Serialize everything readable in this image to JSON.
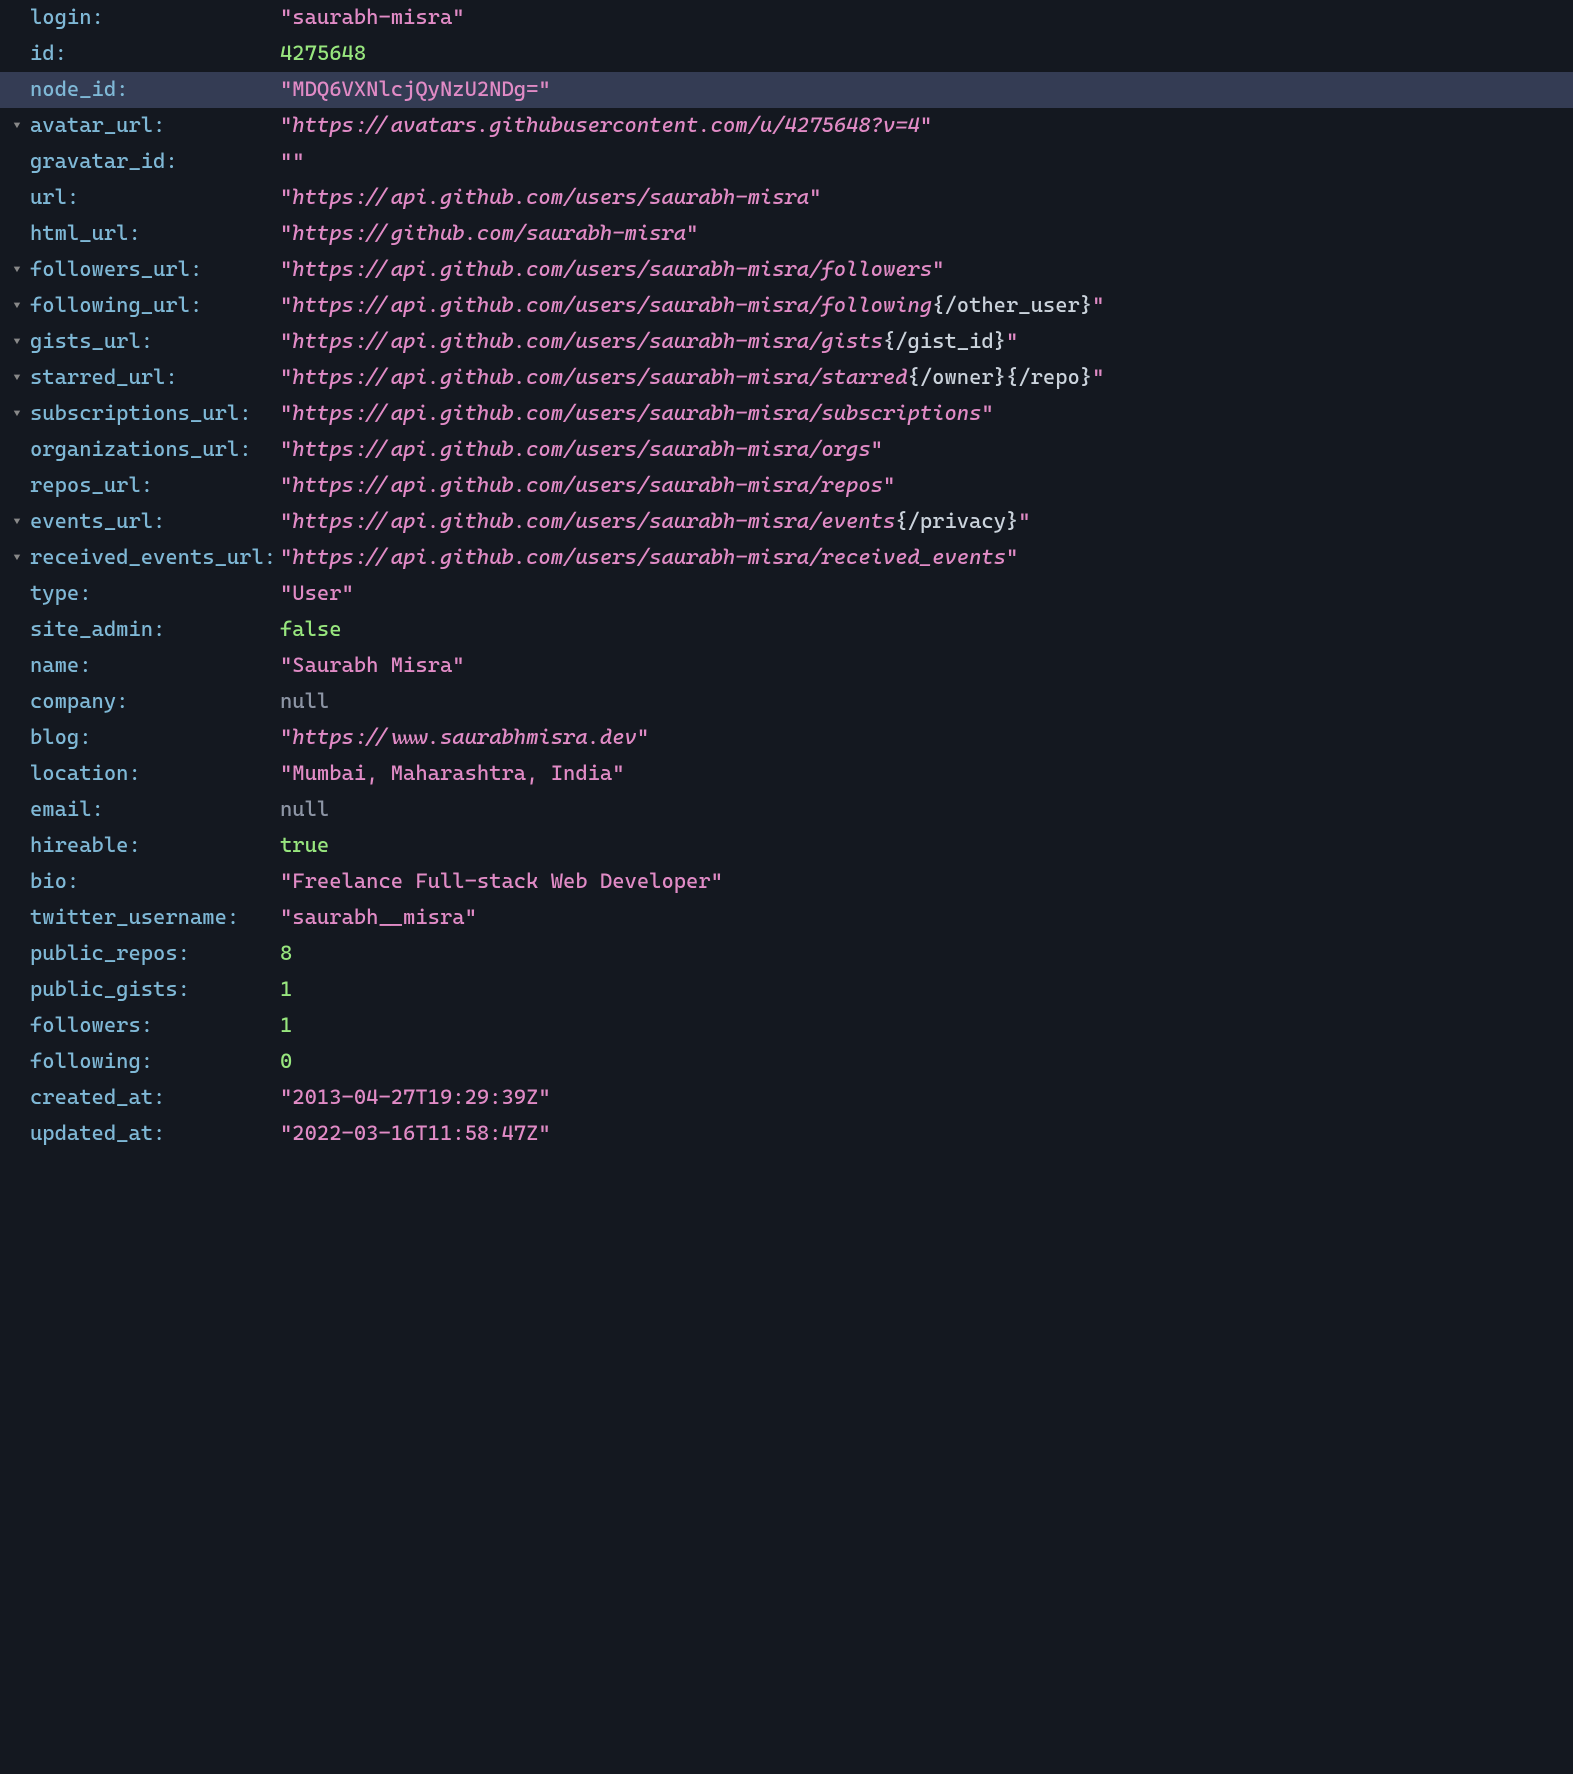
{
  "rows": [
    {
      "key": "login",
      "type": "string",
      "value": "saurabh-misra",
      "expandable": false,
      "highlighted": false
    },
    {
      "key": "id",
      "type": "number",
      "value": "4275648",
      "expandable": false,
      "highlighted": false
    },
    {
      "key": "node_id",
      "type": "string",
      "value": "MDQ6VXNlcjQyNzU2NDg=",
      "expandable": false,
      "highlighted": true
    },
    {
      "key": "avatar_url",
      "type": "url",
      "url": "https://avatars.githubusercontent.com/u/4275648?v=4",
      "template": "",
      "expandable": true,
      "highlighted": false
    },
    {
      "key": "gravatar_id",
      "type": "string",
      "value": "",
      "expandable": false,
      "highlighted": false
    },
    {
      "key": "url",
      "type": "url",
      "url": "https://api.github.com/users/saurabh-misra",
      "template": "",
      "expandable": false,
      "highlighted": false
    },
    {
      "key": "html_url",
      "type": "url",
      "url": "https://github.com/saurabh-misra",
      "template": "",
      "expandable": false,
      "highlighted": false
    },
    {
      "key": "followers_url",
      "type": "url",
      "url": "https://api.github.com/users/saurabh-misra/followers",
      "template": "",
      "expandable": true,
      "highlighted": false
    },
    {
      "key": "following_url",
      "type": "url",
      "url": "https://api.github.com/users/saurabh-misra/following",
      "template": "{/other_user}",
      "expandable": true,
      "highlighted": false
    },
    {
      "key": "gists_url",
      "type": "url",
      "url": "https://api.github.com/users/saurabh-misra/gists",
      "template": "{/gist_id}",
      "expandable": true,
      "highlighted": false
    },
    {
      "key": "starred_url",
      "type": "url",
      "url": "https://api.github.com/users/saurabh-misra/starred",
      "template": "{/owner}{/repo}",
      "expandable": true,
      "highlighted": false
    },
    {
      "key": "subscriptions_url",
      "type": "url",
      "url": "https://api.github.com/users/saurabh-misra/subscriptions",
      "template": "",
      "expandable": true,
      "highlighted": false
    },
    {
      "key": "organizations_url",
      "type": "url",
      "url": "https://api.github.com/users/saurabh-misra/orgs",
      "template": "",
      "expandable": false,
      "highlighted": false
    },
    {
      "key": "repos_url",
      "type": "url",
      "url": "https://api.github.com/users/saurabh-misra/repos",
      "template": "",
      "expandable": false,
      "highlighted": false
    },
    {
      "key": "events_url",
      "type": "url",
      "url": "https://api.github.com/users/saurabh-misra/events",
      "template": "{/privacy}",
      "expandable": true,
      "highlighted": false
    },
    {
      "key": "received_events_url",
      "type": "url",
      "url": "https://api.github.com/users/saurabh-misra/received_events",
      "template": "",
      "expandable": true,
      "highlighted": false
    },
    {
      "key": "type",
      "type": "string",
      "value": "User",
      "expandable": false,
      "highlighted": false
    },
    {
      "key": "site_admin",
      "type": "bool",
      "value": "false",
      "expandable": false,
      "highlighted": false
    },
    {
      "key": "name",
      "type": "string",
      "value": "Saurabh Misra",
      "expandable": false,
      "highlighted": false
    },
    {
      "key": "company",
      "type": "null",
      "value": "null",
      "expandable": false,
      "highlighted": false
    },
    {
      "key": "blog",
      "type": "url",
      "url": "https://www.saurabhmisra.dev",
      "template": "",
      "expandable": false,
      "highlighted": false
    },
    {
      "key": "location",
      "type": "string",
      "value": "Mumbai, Maharashtra, India",
      "expandable": false,
      "highlighted": false
    },
    {
      "key": "email",
      "type": "null",
      "value": "null",
      "expandable": false,
      "highlighted": false
    },
    {
      "key": "hireable",
      "type": "bool",
      "value": "true",
      "expandable": false,
      "highlighted": false
    },
    {
      "key": "bio",
      "type": "string",
      "value": "Freelance Full-stack Web Developer",
      "expandable": false,
      "highlighted": false
    },
    {
      "key": "twitter_username",
      "type": "string",
      "value": "saurabh__misra",
      "expandable": false,
      "highlighted": false
    },
    {
      "key": "public_repos",
      "type": "number",
      "value": "8",
      "expandable": false,
      "highlighted": false
    },
    {
      "key": "public_gists",
      "type": "number",
      "value": "1",
      "expandable": false,
      "highlighted": false
    },
    {
      "key": "followers",
      "type": "number",
      "value": "1",
      "expandable": false,
      "highlighted": false
    },
    {
      "key": "following",
      "type": "number",
      "value": "0",
      "expandable": false,
      "highlighted": false
    },
    {
      "key": "created_at",
      "type": "string",
      "value": "2013-04-27T19:29:39Z",
      "expandable": false,
      "highlighted": false
    },
    {
      "key": "updated_at",
      "type": "string",
      "value": "2022-03-16T11:58:47Z",
      "expandable": false,
      "highlighted": false
    }
  ]
}
